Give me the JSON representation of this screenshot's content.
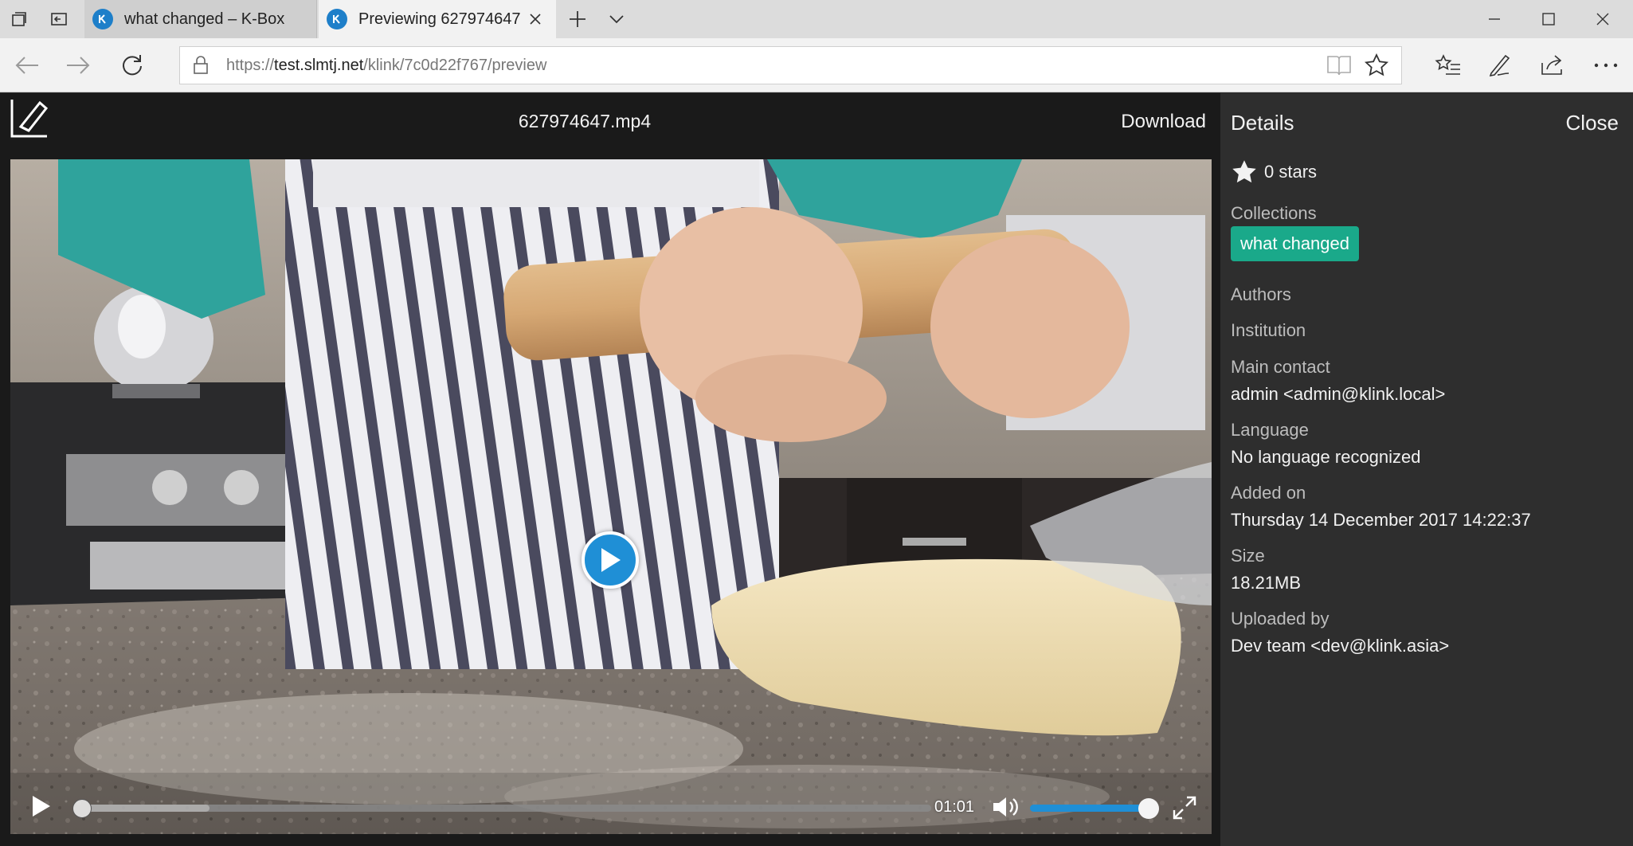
{
  "browser": {
    "tabs": [
      {
        "title": "what changed – K-Box",
        "active": false
      },
      {
        "title": "Previewing 627974647.",
        "active": true
      }
    ],
    "url": {
      "scheme": "https://",
      "host": "test.slmtj.net",
      "path": "/klink/7c0d22f767/preview"
    },
    "icons": {
      "back": "back-arrow-icon",
      "forward": "forward-arrow-icon",
      "refresh": "refresh-icon",
      "lock": "lock-icon",
      "reading_view": "reading-view-icon",
      "favorite": "star-outline-icon",
      "favorites_hub": "favorites-hub-icon",
      "notes": "pen-icon",
      "share": "share-icon",
      "more": "more-dots-icon"
    }
  },
  "viewer": {
    "file_name": "627974647.mp4",
    "download_label": "Download",
    "player": {
      "current_time": "01:01",
      "progress_fraction": 0.0,
      "buffered_fraction": 0.15,
      "volume_fraction": 1.0
    }
  },
  "details": {
    "title": "Details",
    "close_label": "Close",
    "stars": "0 stars",
    "collections_label": "Collections",
    "collections": [
      "what changed"
    ],
    "authors_label": "Authors",
    "institution_label": "Institution",
    "main_contact_label": "Main contact",
    "main_contact_value": "admin <admin@klink.local>",
    "language_label": "Language",
    "language_value": "No language recognized",
    "added_on_label": "Added on",
    "added_on_value": "Thursday 14 December 2017 14:22:37",
    "size_label": "Size",
    "size_value": "18.21MB",
    "uploaded_by_label": "Uploaded by",
    "uploaded_by_value": "Dev team <dev@klink.asia>"
  },
  "colors": {
    "accent_blue": "#1f8fd6",
    "tag_green": "#1aa98a",
    "panel_bg": "#2e2e2e",
    "viewer_bg": "#1a1a1a"
  }
}
